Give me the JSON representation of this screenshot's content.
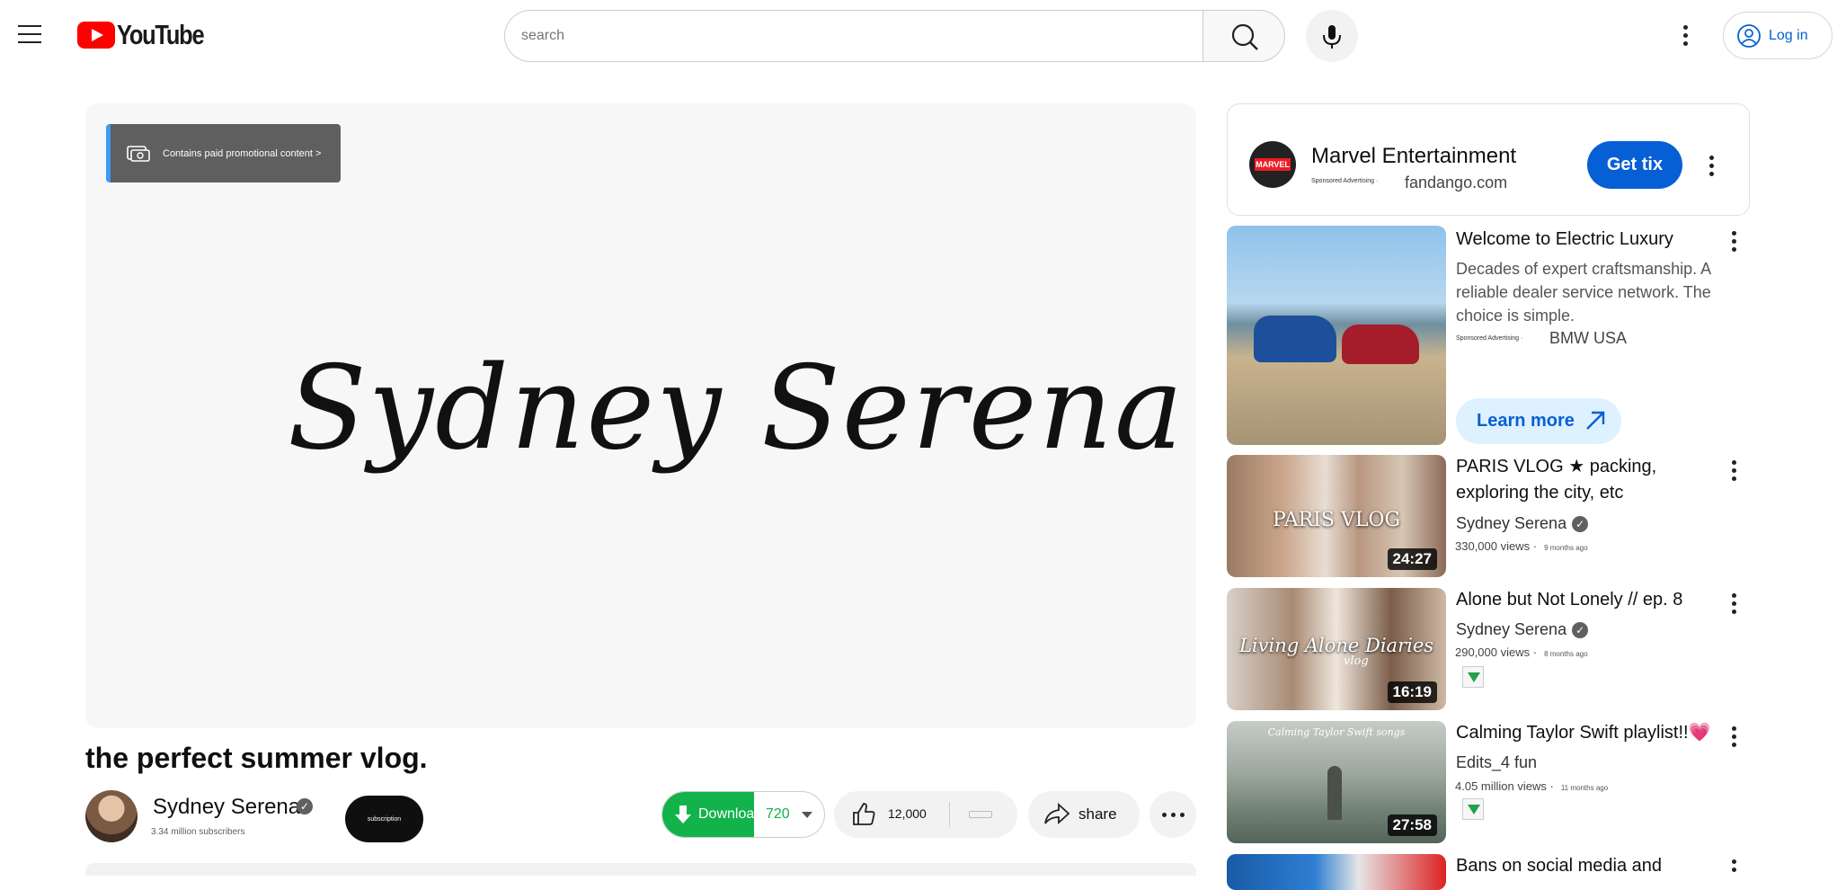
{
  "header": {
    "logo_text": "YouTube",
    "search_placeholder": "search",
    "login_label": "Log in"
  },
  "player": {
    "promo_label": "Contains paid promotional content >",
    "signature_text": "Sydney Serena"
  },
  "video": {
    "title": "the perfect summer vlog.",
    "channel_name": "Sydney Serena",
    "subscribers": "3.34 million subscribers",
    "subscribe_label": "subscription",
    "download_label": "Download",
    "download_quality": "720",
    "like_count": "12,000",
    "share_label": "share"
  },
  "sidebar": {
    "ad": {
      "name": "Marvel Entertainment",
      "sponsored": "Sponsored Advertising ·",
      "domain": "fandango.com",
      "cta": "Get tix",
      "logo_text": "MARVEL"
    },
    "bmw_ad": {
      "title": "Welcome to Electric Luxury",
      "description": "Decades of expert craftsmanship. A reliable dealer service network. The choice is simple.",
      "sponsored": "Sponsored Advertising ·",
      "brand": "BMW USA",
      "cta": "Learn more"
    },
    "videos": [
      {
        "title": "PARIS VLOG ★ packing, exploring the city, etc",
        "channel": "Sydney Serena",
        "views": "330,000 views ·",
        "age": "9 months ago",
        "duration": "24:27",
        "thumb_text": "PARIS VLOG"
      },
      {
        "title": "Alone but Not Lonely // ep. 8",
        "channel": "Sydney Serena",
        "views": "290,000 views ·",
        "age": "8 months ago",
        "duration": "16:19",
        "thumb_text": "Living Alone Diaries",
        "thumb_sub": "vlog"
      },
      {
        "title": "Calming Taylor Swift playlist!!💗",
        "channel": "Edits_4 fun",
        "views": "4.05 million views ·",
        "age": "11 months ago",
        "duration": "27:58",
        "thumb_text": "Calming Taylor Swift songs"
      },
      {
        "title": "Bans on social media and"
      }
    ]
  },
  "colors": {
    "brand_red": "#ff0000",
    "link_blue": "#065fd4",
    "download_green": "#13b34b"
  }
}
